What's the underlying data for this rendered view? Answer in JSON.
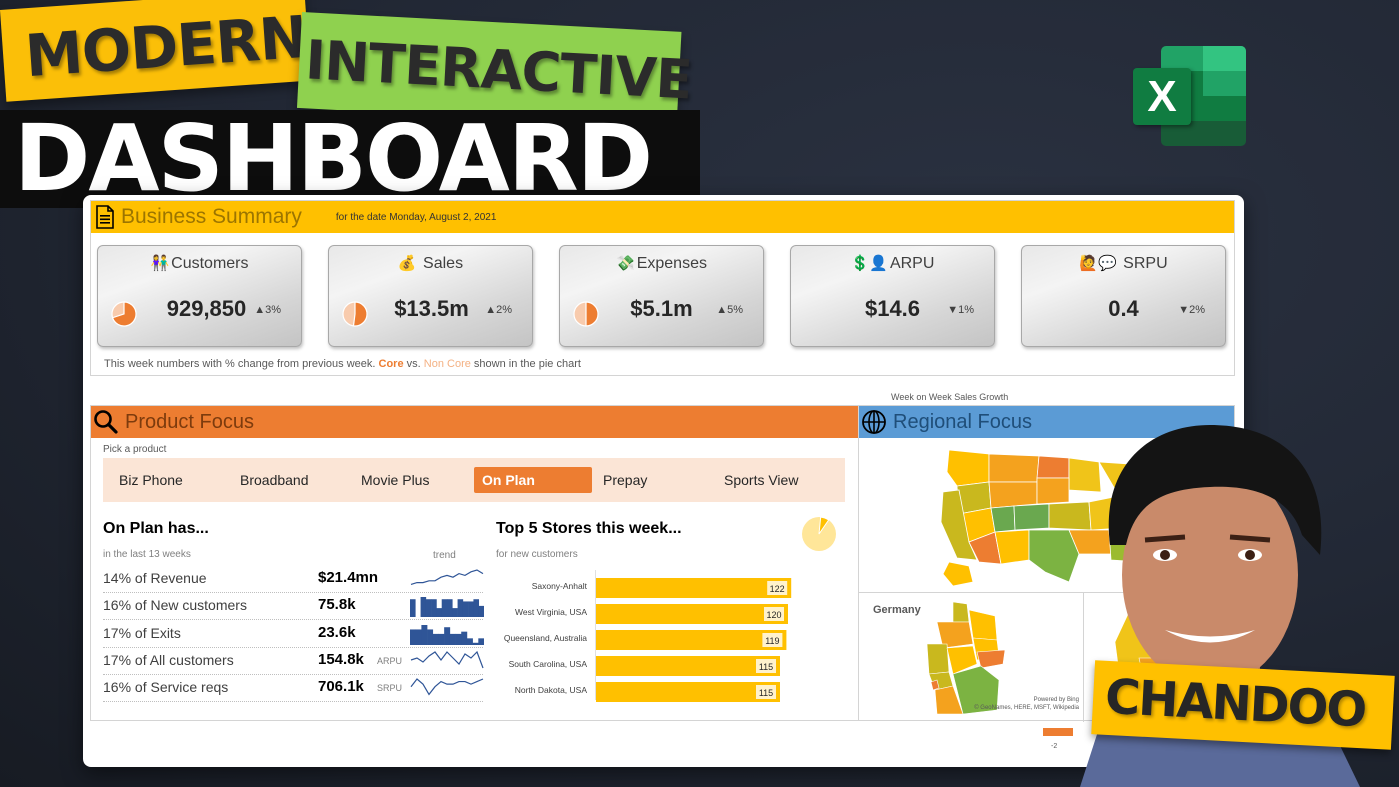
{
  "thumbnail": {
    "banner_modern": "MODERN",
    "banner_interactive": "INTERACTIVE",
    "banner_dashboard": "DASHBOARD",
    "presenter_label": "CHANDOO",
    "app_logo_letter": "X",
    "colors": {
      "yellow": "#ffc000",
      "green": "#8fd14f",
      "excel_green": "#107c41"
    }
  },
  "business_summary": {
    "title": "Business Summary",
    "date_text": "for the date Monday, August 2, 2021",
    "kpis": [
      {
        "label": "Customers",
        "emoji": "👫",
        "value": "929,850",
        "change": "▲3%",
        "core_share": 0.7,
        "has_pie": true
      },
      {
        "label": "Sales",
        "emoji": "💰",
        "value": "$13.5m",
        "change": "▲2%",
        "core_share": 0.52,
        "has_pie": true
      },
      {
        "label": "Expenses",
        "emoji": "💸",
        "value": "$5.1m",
        "change": "▲5%",
        "core_share": 0.5,
        "has_pie": true
      },
      {
        "label": "ARPU",
        "emoji": "💲👤",
        "value": "$14.6",
        "change": "▼1%",
        "has_pie": false
      },
      {
        "label": "SRPU",
        "emoji": "🙋💬",
        "value": "0.4",
        "change": "▼2%",
        "has_pie": false
      }
    ],
    "note_prefix": "This week numbers with % change from previous week.",
    "note_core": "Core",
    "note_vs": "vs.",
    "note_noncore": "Non Core",
    "note_suffix": "shown in the pie chart",
    "colors": {
      "header": "#ffc000",
      "core": "#ed7d31",
      "noncore": "#f8cbad"
    }
  },
  "product_focus": {
    "title": "Product Focus",
    "pick_label": "Pick a product",
    "products": [
      "Biz Phone",
      "Broadband",
      "Movie Plus",
      "On Plan",
      "Prepay",
      "Sports View"
    ],
    "selected_product": "On Plan",
    "summary_title": "On Plan has...",
    "summary_subtitle": "in the last 13 weeks",
    "trend_label": "trend",
    "metrics": [
      {
        "label": "14% of Revenue",
        "value": "$21.4mn",
        "tag": "",
        "spark_type": "line",
        "spark": [
          2,
          3,
          3,
          4,
          4,
          6,
          7,
          6,
          8,
          7,
          9,
          10,
          8
        ]
      },
      {
        "label": "16% of New customers",
        "value": "75.8k",
        "tag": "",
        "spark_type": "column",
        "spark": [
          8,
          0,
          9,
          8,
          8,
          4,
          8,
          8,
          4,
          8,
          7,
          7,
          8,
          5
        ]
      },
      {
        "label": "17% of Exits",
        "value": "23.6k",
        "tag": "",
        "spark_type": "column",
        "spark": [
          7,
          7,
          9,
          7,
          5,
          5,
          8,
          5,
          5,
          6,
          3,
          1,
          3
        ]
      },
      {
        "label": "17% of All customers",
        "value": "154.8k",
        "tag": "ARPU",
        "spark_type": "line",
        "spark": [
          5,
          6,
          4,
          7,
          9,
          5,
          9,
          6,
          3,
          8,
          6,
          9,
          1
        ]
      },
      {
        "label": "16% of Service reqs",
        "value": "706.1k",
        "tag": "SRPU",
        "spark_type": "line",
        "spark": [
          4,
          7,
          5,
          1,
          4,
          6,
          5,
          5,
          6,
          6,
          5,
          6,
          7
        ]
      }
    ],
    "top5_title": "Top 5 Stores this week...",
    "top5_subtitle": "for new customers",
    "top5_share": 0.08,
    "colors": {
      "header": "#ed7d31",
      "slicer_bg": "#fbe5d6",
      "spark": "#2f5597",
      "bar": "#ffc000"
    }
  },
  "chart_data": {
    "type": "bar",
    "title": "Top 5 Stores this week...",
    "subtitle": "for new customers",
    "orientation": "horizontal",
    "categories": [
      "Saxony-Anhalt",
      "West Virginia, USA",
      "Queensland, Australia",
      "South Carolina, USA",
      "North Dakota, USA"
    ],
    "values": [
      122,
      120,
      119,
      115,
      115
    ],
    "xlim": [
      0,
      125
    ],
    "data_labels": true,
    "grid": false
  },
  "regional_focus": {
    "title": "Regional Focus",
    "map_caption": "Week on Week Sales Growth",
    "germany_label": "Germany",
    "bing_credit_line1": "Powered by Bing",
    "bing_credit_line2": "© GeoNames, HERE, MSFT, Wikipedia",
    "legend_min_label": "-2",
    "colors": {
      "header": "#5b9bd5"
    }
  }
}
